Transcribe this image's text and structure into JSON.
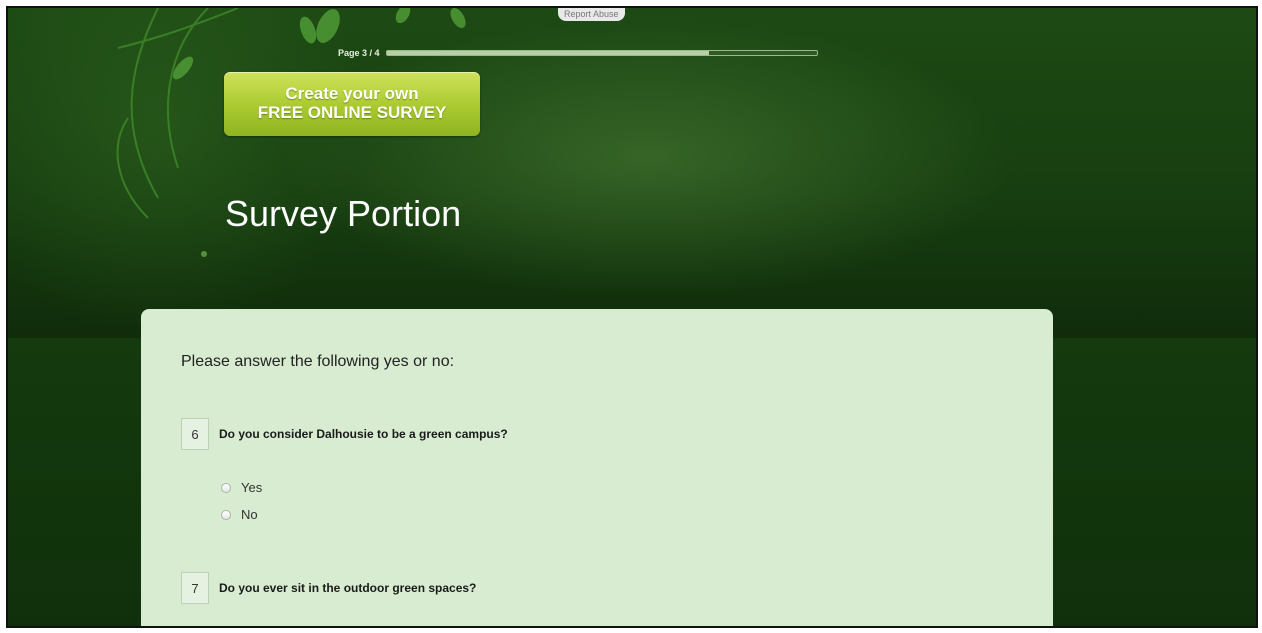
{
  "header": {
    "report_abuse": "Report Abuse",
    "page_label": "Page 3 / 4",
    "progress": 0.75
  },
  "cta": {
    "line1": "Create your own",
    "line2": "FREE ONLINE SURVEY"
  },
  "survey": {
    "title": "Survey Portion",
    "intro": "Please answer the following yes or no:",
    "questions": [
      {
        "number": "6",
        "text": "Do you consider Dalhousie to be a green campus?",
        "options": [
          "Yes",
          "No"
        ]
      },
      {
        "number": "7",
        "text": "Do you ever sit in the outdoor green spaces?"
      }
    ]
  },
  "colors": {
    "background_dark": "#0f2a0a",
    "panel": "#d8ecd2",
    "cta": "#a9c92f"
  }
}
